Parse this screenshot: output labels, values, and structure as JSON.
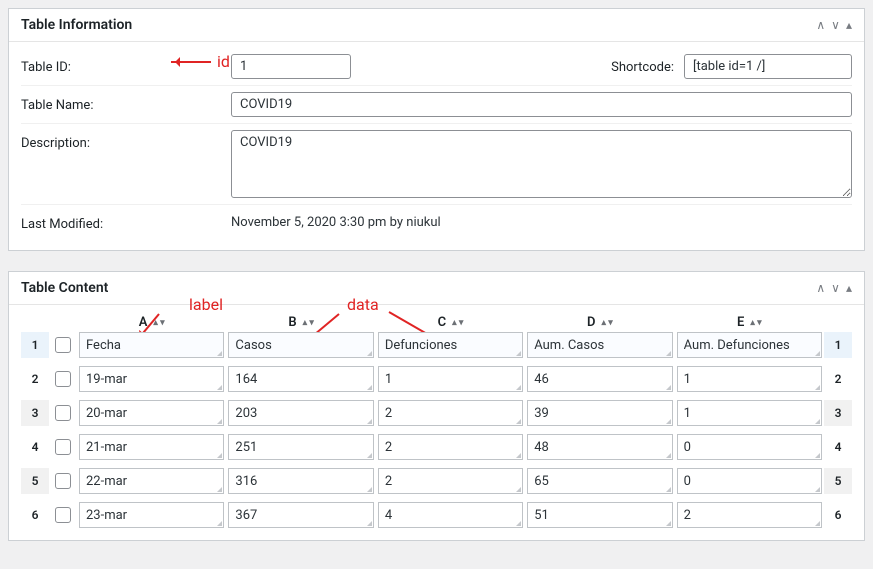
{
  "info_panel": {
    "title": "Table Information",
    "rows": {
      "id_label": "Table ID:",
      "id_value": "1",
      "shortcode_label": "Shortcode:",
      "shortcode_value": "[table id=1 /]",
      "name_label": "Table Name:",
      "name_value": "COVID19",
      "desc_label": "Description:",
      "desc_value": "COVID19",
      "modified_label": "Last Modified:",
      "modified_value": "November 5, 2020 3:30 pm by niukul"
    }
  },
  "annotations": {
    "id": "id",
    "label": "label",
    "data": "data"
  },
  "content_panel": {
    "title": "Table Content",
    "columns": [
      "A",
      "B",
      "C",
      "D",
      "E"
    ],
    "rows": [
      {
        "n": "1",
        "cells": [
          "Fecha",
          "Casos",
          "Defunciones",
          "Aum. Casos",
          "Aum. Defunciones"
        ]
      },
      {
        "n": "2",
        "cells": [
          "19-mar",
          "164",
          "1",
          "46",
          "1"
        ]
      },
      {
        "n": "3",
        "cells": [
          "20-mar",
          "203",
          "2",
          "39",
          "1"
        ]
      },
      {
        "n": "4",
        "cells": [
          "21-mar",
          "251",
          "2",
          "48",
          "0"
        ]
      },
      {
        "n": "5",
        "cells": [
          "22-mar",
          "316",
          "2",
          "65",
          "0"
        ]
      },
      {
        "n": "6",
        "cells": [
          "23-mar",
          "367",
          "4",
          "51",
          "2"
        ]
      }
    ]
  }
}
